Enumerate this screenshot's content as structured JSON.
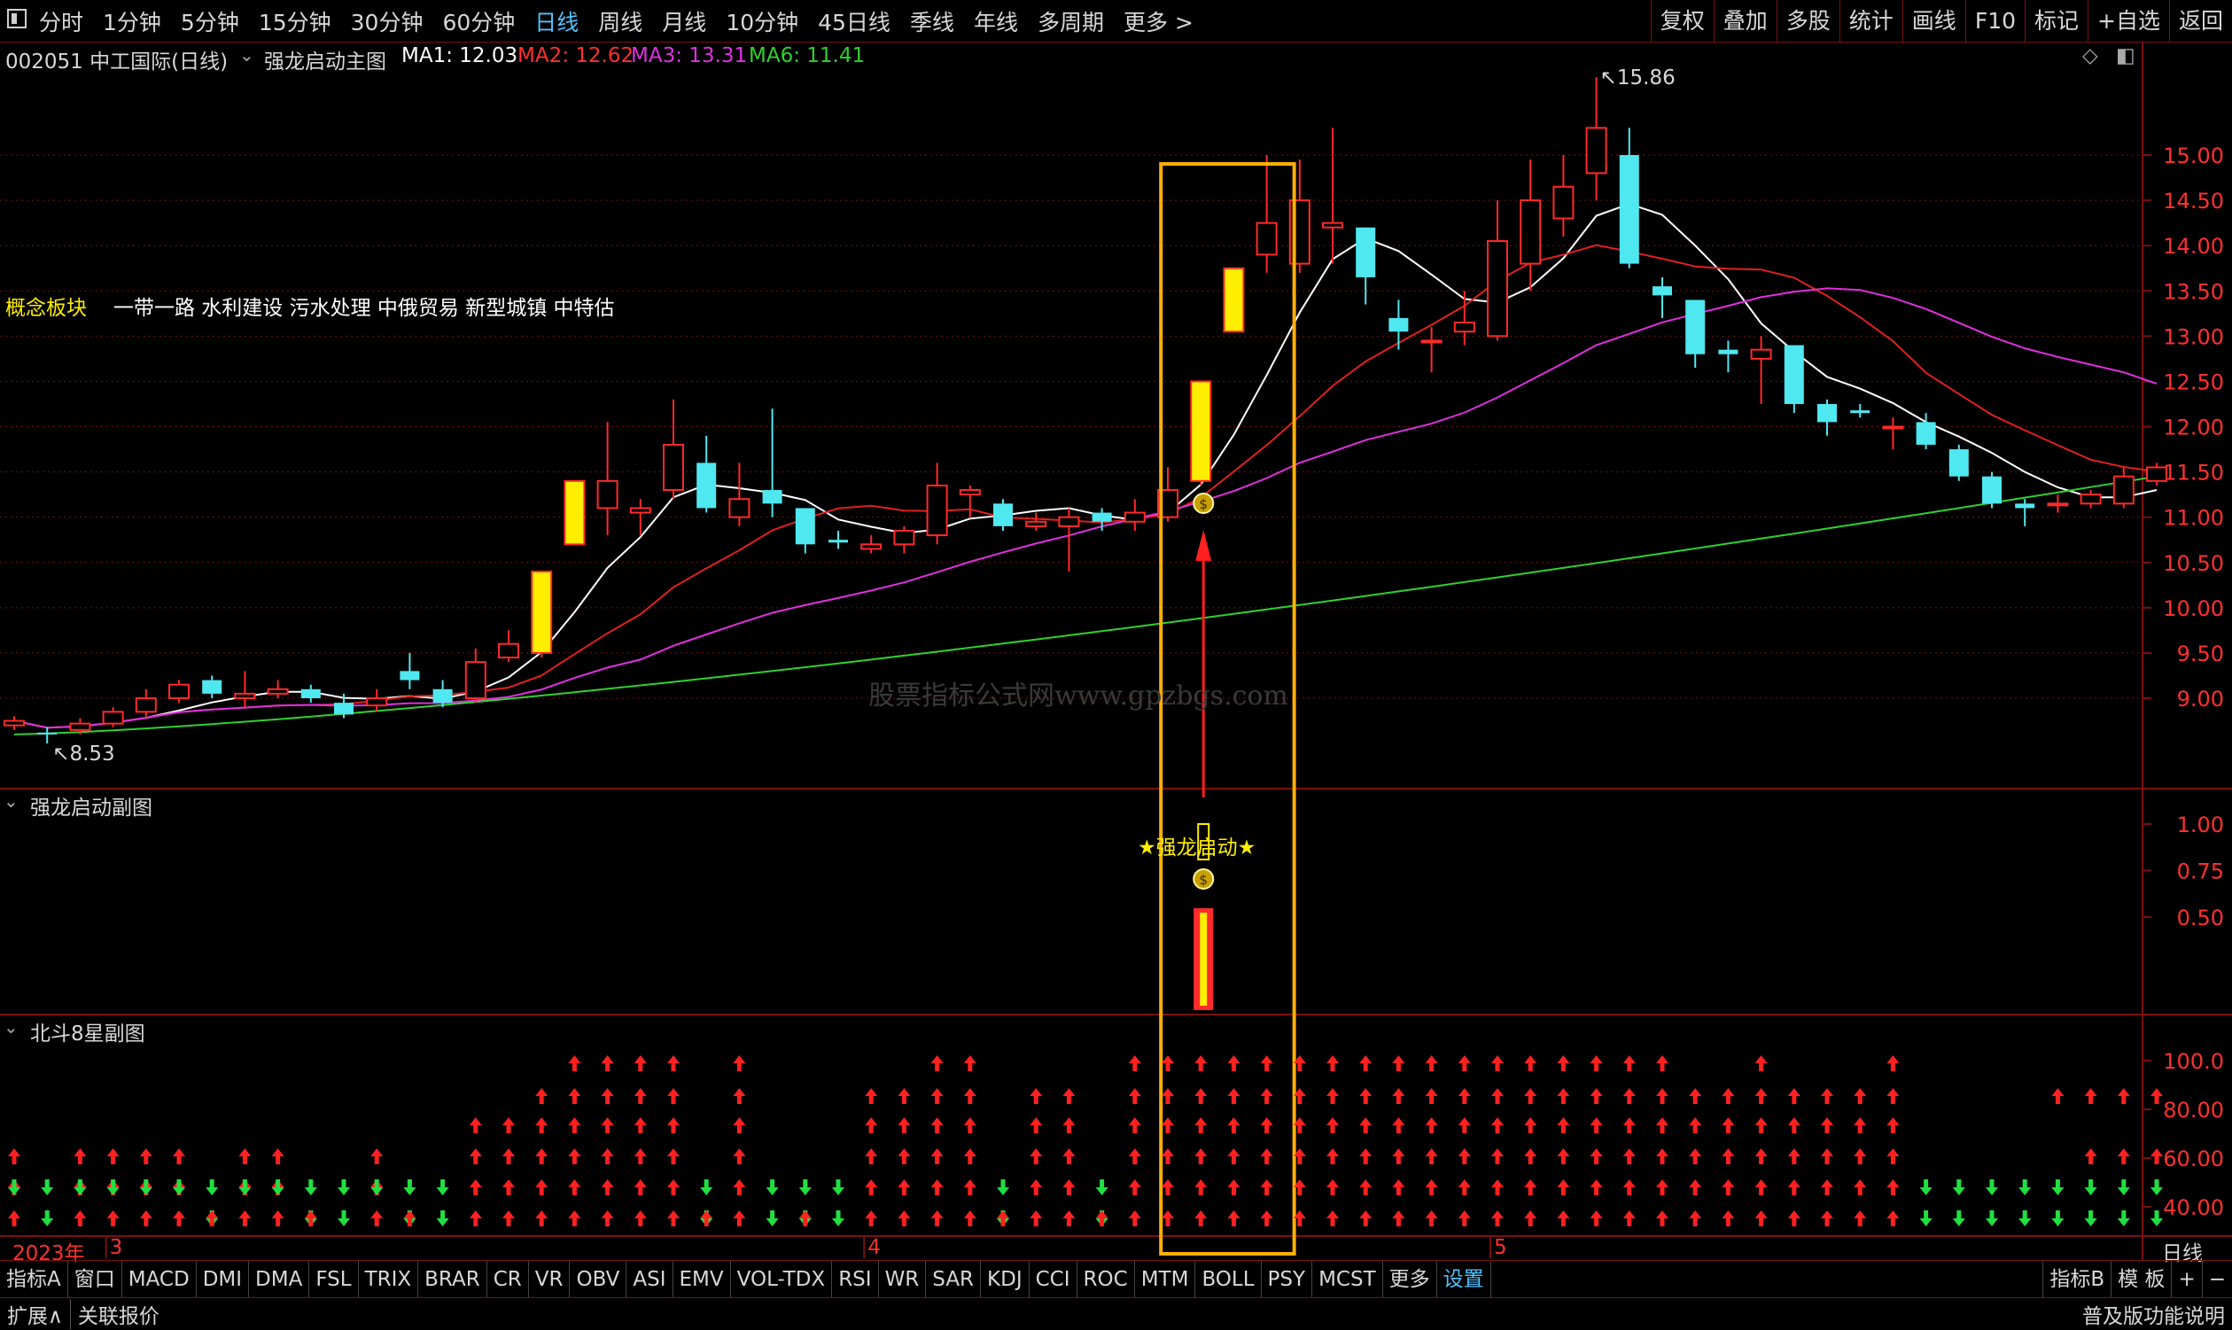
{
  "toolbar": {
    "periods": [
      {
        "label": "分时"
      },
      {
        "label": "1分钟"
      },
      {
        "label": "5分钟"
      },
      {
        "label": "15分钟"
      },
      {
        "label": "30分钟"
      },
      {
        "label": "60分钟"
      },
      {
        "label": "日线",
        "active": true
      },
      {
        "label": "周线"
      },
      {
        "label": "月线"
      },
      {
        "label": "10分钟"
      },
      {
        "label": "45日线"
      },
      {
        "label": "季线"
      },
      {
        "label": "年线"
      },
      {
        "label": "多周期"
      },
      {
        "label": "更多 >"
      }
    ],
    "tools": [
      "复权",
      "叠加",
      "多股",
      "统计",
      "画线",
      "F10",
      "标记",
      "+自选",
      "返回"
    ]
  },
  "header": {
    "stock": "002051 中工国际(日线)",
    "indicator": "强龙启动主图",
    "ma1": "MA1: 12.03",
    "ma2": "MA2: 12.62",
    "ma3": "MA3: 13.31",
    "ma6": "MA6: 11.41"
  },
  "concept": {
    "label": "概念板块",
    "text": "一带一路 水利建设 污水处理 中俄贸易 新型城镇 中特估"
  },
  "watermark": "股票指标公式网www.gpzbgs.com",
  "colors": {
    "up": "#ff2a2a",
    "down": "#4fe7f0",
    "signal": "#ffee00",
    "ma1": "#ffffff",
    "ma2": "#e02020",
    "ma3": "#e030e0",
    "ma6": "#30d030",
    "box": "#ffb000",
    "grid": "#7a1010"
  },
  "main_chart": {
    "high_label": "15.86",
    "low_label": "8.53",
    "y_ticks": [
      "15.00",
      "14.50",
      "14.00",
      "13.50",
      "13.00",
      "12.50",
      "12.00",
      "11.50",
      "11.00",
      "10.50",
      "10.00",
      "9.50",
      "9.00"
    ],
    "y_values": [
      15.0,
      14.5,
      14.0,
      13.5,
      13.0,
      12.5,
      12.0,
      11.5,
      11.0,
      10.5,
      10.0,
      9.5,
      9.0
    ],
    "candles": [
      [
        8.7,
        8.75,
        8.65,
        8.8
      ],
      [
        8.62,
        8.6,
        8.5,
        8.68
      ],
      [
        8.65,
        8.72,
        8.6,
        8.78
      ],
      [
        8.72,
        8.85,
        8.68,
        8.9
      ],
      [
        8.85,
        9.0,
        8.8,
        9.1
      ],
      [
        9.0,
        9.15,
        8.95,
        9.2
      ],
      [
        9.2,
        9.05,
        9.0,
        9.25
      ],
      [
        9.0,
        9.05,
        8.9,
        9.3
      ],
      [
        9.05,
        9.1,
        9.0,
        9.2
      ],
      [
        9.1,
        9.0,
        8.95,
        9.15
      ],
      [
        8.95,
        8.82,
        8.78,
        9.05
      ],
      [
        8.92,
        9.0,
        8.85,
        9.1
      ],
      [
        9.3,
        9.2,
        9.1,
        9.5
      ],
      [
        9.1,
        8.95,
        8.9,
        9.2
      ],
      [
        9.0,
        9.4,
        8.95,
        9.55
      ],
      [
        9.45,
        9.6,
        9.4,
        9.75
      ],
      [
        9.5,
        10.4,
        9.45,
        10.4
      ],
      [
        10.7,
        11.4,
        10.7,
        11.4
      ],
      [
        11.1,
        11.4,
        10.8,
        12.05
      ],
      [
        11.05,
        11.1,
        10.8,
        11.2
      ],
      [
        11.3,
        11.8,
        11.2,
        12.3
      ],
      [
        11.6,
        11.1,
        11.05,
        11.9
      ],
      [
        11.0,
        11.2,
        10.9,
        11.6
      ],
      [
        11.3,
        11.15,
        11.0,
        12.2
      ],
      [
        11.1,
        10.7,
        10.6,
        11.1
      ],
      [
        10.75,
        10.72,
        10.65,
        10.85
      ],
      [
        10.65,
        10.7,
        10.6,
        10.8
      ],
      [
        10.7,
        10.85,
        10.6,
        10.9
      ],
      [
        10.8,
        11.35,
        10.7,
        11.6
      ],
      [
        11.25,
        11.3,
        11.0,
        11.35
      ],
      [
        11.15,
        10.9,
        10.85,
        11.2
      ],
      [
        10.9,
        10.95,
        10.85,
        11.05
      ],
      [
        10.9,
        11.0,
        10.4,
        11.1
      ],
      [
        11.05,
        10.95,
        10.85,
        11.1
      ],
      [
        10.95,
        11.05,
        10.85,
        11.2
      ],
      [
        11.0,
        11.3,
        10.95,
        11.55
      ],
      [
        11.4,
        12.5,
        11.35,
        12.5
      ],
      [
        13.05,
        13.75,
        13.05,
        13.75
      ],
      [
        13.9,
        14.25,
        13.7,
        15.0
      ],
      [
        13.8,
        14.5,
        13.7,
        14.95
      ],
      [
        14.2,
        14.25,
        13.8,
        15.3
      ],
      [
        14.2,
        13.65,
        13.35,
        14.2
      ],
      [
        13.2,
        13.05,
        12.85,
        13.4
      ],
      [
        12.95,
        12.95,
        12.6,
        13.1
      ],
      [
        13.05,
        13.15,
        12.9,
        13.5
      ],
      [
        13.0,
        14.05,
        12.95,
        14.5
      ],
      [
        13.8,
        14.5,
        13.5,
        14.95
      ],
      [
        14.3,
        14.65,
        14.1,
        15.0
      ],
      [
        14.8,
        15.3,
        14.5,
        15.86
      ],
      [
        15.0,
        13.8,
        13.75,
        15.3
      ],
      [
        13.55,
        13.45,
        13.2,
        13.65
      ],
      [
        13.4,
        12.8,
        12.65,
        13.4
      ],
      [
        12.85,
        12.8,
        12.6,
        12.95
      ],
      [
        12.75,
        12.85,
        12.25,
        13.0
      ],
      [
        12.9,
        12.25,
        12.15,
        12.9
      ],
      [
        12.25,
        12.05,
        11.9,
        12.3
      ],
      [
        12.18,
        12.15,
        12.1,
        12.25
      ],
      [
        12.0,
        12.0,
        11.75,
        12.1
      ],
      [
        12.05,
        11.8,
        11.75,
        12.15
      ],
      [
        11.75,
        11.45,
        11.4,
        11.8
      ],
      [
        11.45,
        11.15,
        11.1,
        11.5
      ],
      [
        11.15,
        11.1,
        10.9,
        11.2
      ],
      [
        11.15,
        11.15,
        11.05,
        11.25
      ],
      [
        11.15,
        11.25,
        11.1,
        11.3
      ],
      [
        11.15,
        11.45,
        11.1,
        11.55
      ],
      [
        11.4,
        11.55,
        11.35,
        11.6
      ]
    ],
    "signal_bars": [
      16,
      17,
      36,
      37
    ]
  },
  "sub1": {
    "title": "强龙启动副图",
    "label": "★强龙启动★",
    "y_ticks": [
      "1.00",
      "0.75",
      "0.50"
    ],
    "y_values": [
      1.0,
      0.75,
      0.5
    ]
  },
  "sub2": {
    "title": "北斗8星副图",
    "y_ticks": [
      "100.0",
      "80.00",
      "60.00",
      "40.00"
    ],
    "y_values": [
      100,
      80,
      60,
      40
    ]
  },
  "xaxis": {
    "year_label": "2023年",
    "month_labels": [
      {
        "text": "3",
        "bar": 3
      },
      {
        "text": "4",
        "bar": 26
      },
      {
        "text": "5",
        "bar": 45
      }
    ]
  },
  "tabs": {
    "items": [
      "指标A",
      "窗口",
      "MACD",
      "DMI",
      "DMA",
      "FSL",
      "TRIX",
      "BRAR",
      "CR",
      "VR",
      "OBV",
      "ASI",
      "EMV",
      "VOL-TDX",
      "RSI",
      "WR",
      "SAR",
      "KDJ",
      "CCI",
      "ROC",
      "MTM",
      "BOLL",
      "PSY",
      "MCST",
      "更多",
      "设置"
    ],
    "right": [
      "指标B",
      "模 板"
    ],
    "period_right": "日线"
  },
  "bottom": {
    "left": [
      "扩展∧",
      "关联报价"
    ],
    "right": "普及版功能说明"
  }
}
